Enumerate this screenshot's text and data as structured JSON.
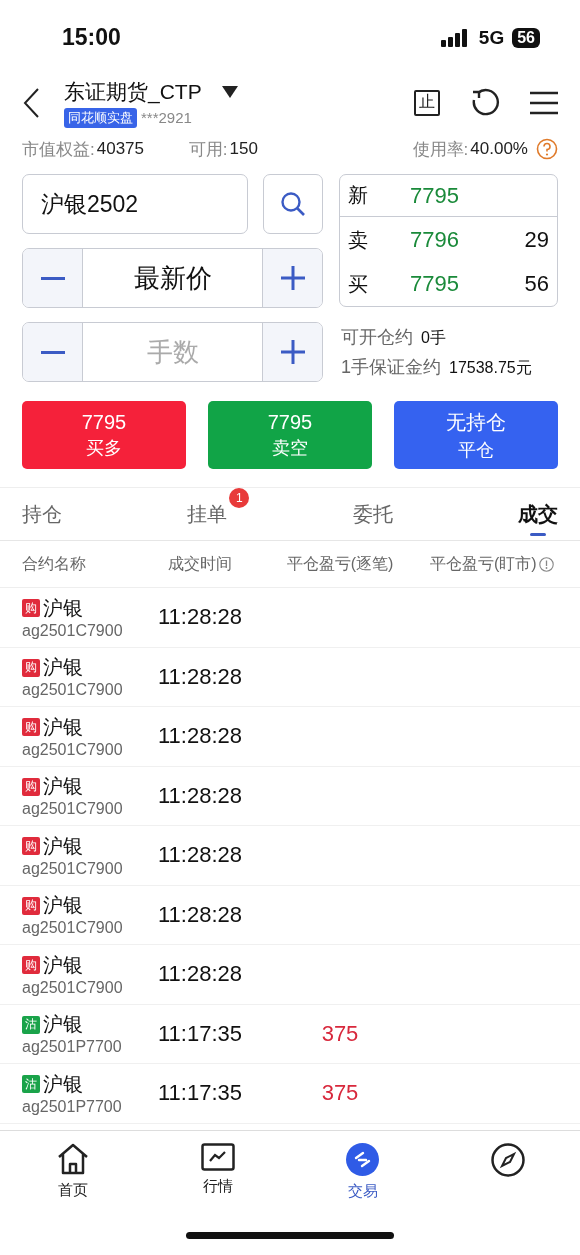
{
  "status_bar": {
    "time": "15:00",
    "network": "5G",
    "battery": "56"
  },
  "header": {
    "title": "东证期货_CTP",
    "badge": "同花顺实盘",
    "account": "***2921",
    "stop_button": "止"
  },
  "summary": [
    {
      "label": "市值权益:",
      "value": "40375"
    },
    {
      "label": "可用:",
      "value": "150"
    },
    {
      "label": "使用率:",
      "value": "40.00%"
    }
  ],
  "order_form": {
    "contract": "沪银2502",
    "price": "最新价",
    "quantity_placeholder": "手数"
  },
  "quote": {
    "last_label": "新",
    "last": "7795",
    "levels": [
      {
        "label": "卖",
        "price": "7796",
        "volume": "29"
      },
      {
        "label": "买",
        "price": "7795",
        "volume": "56"
      }
    ]
  },
  "availability": [
    {
      "label": "可开仓约",
      "value": "0手"
    },
    {
      "label": "1手保证金约",
      "value": "17538.75元"
    }
  ],
  "actions": [
    {
      "kind": "buy",
      "price": "7795",
      "label": "买多"
    },
    {
      "kind": "sell",
      "price": "7795",
      "label": "卖空"
    },
    {
      "kind": "close",
      "price": "无持仓",
      "label": "平仓"
    }
  ],
  "tabs": [
    {
      "label": "持仓",
      "selected": false
    },
    {
      "label": "挂单",
      "selected": false,
      "badge": "1"
    },
    {
      "label": "委托",
      "selected": false
    },
    {
      "label": "成交",
      "selected": true
    }
  ],
  "table": {
    "columns": [
      "合约名称",
      "成交时间",
      "平仓盈亏(逐笔)",
      "平仓盈亏(盯市)"
    ],
    "rows": [
      {
        "tag": "购",
        "color": "#e02b3c",
        "name": "沪银",
        "code": "ag2501C7900",
        "time": "11:28:28"
      },
      {
        "tag": "购",
        "color": "#e02b3c",
        "name": "沪银",
        "code": "ag2501C7900",
        "time": "11:28:28"
      },
      {
        "tag": "购",
        "color": "#e02b3c",
        "name": "沪银",
        "code": "ag2501C7900",
        "time": "11:28:28"
      },
      {
        "tag": "购",
        "color": "#e02b3c",
        "name": "沪银",
        "code": "ag2501C7900",
        "time": "11:28:28"
      },
      {
        "tag": "购",
        "color": "#e02b3c",
        "name": "沪银",
        "code": "ag2501C7900",
        "time": "11:28:28"
      },
      {
        "tag": "购",
        "color": "#e02b3c",
        "name": "沪银",
        "code": "ag2501C7900",
        "time": "11:28:28"
      },
      {
        "tag": "购",
        "color": "#e02b3c",
        "name": "沪银",
        "code": "ag2501C7900",
        "time": "11:28:28"
      },
      {
        "tag": "沽",
        "color": "#1aa34a",
        "name": "沪银",
        "code": "ag2501P7700",
        "time": "11:17:35",
        "pnl": "375"
      },
      {
        "tag": "沽",
        "color": "#1aa34a",
        "name": "沪银",
        "code": "ag2501P7700",
        "time": "11:17:35",
        "pnl": "375"
      }
    ]
  },
  "nav": [
    {
      "kind": "home",
      "label": "首页",
      "selected": false
    },
    {
      "kind": "chart",
      "label": "行情",
      "selected": false
    },
    {
      "kind": "trade",
      "label": "交易",
      "selected": true
    },
    {
      "kind": "compass",
      "selected": false
    }
  ]
}
